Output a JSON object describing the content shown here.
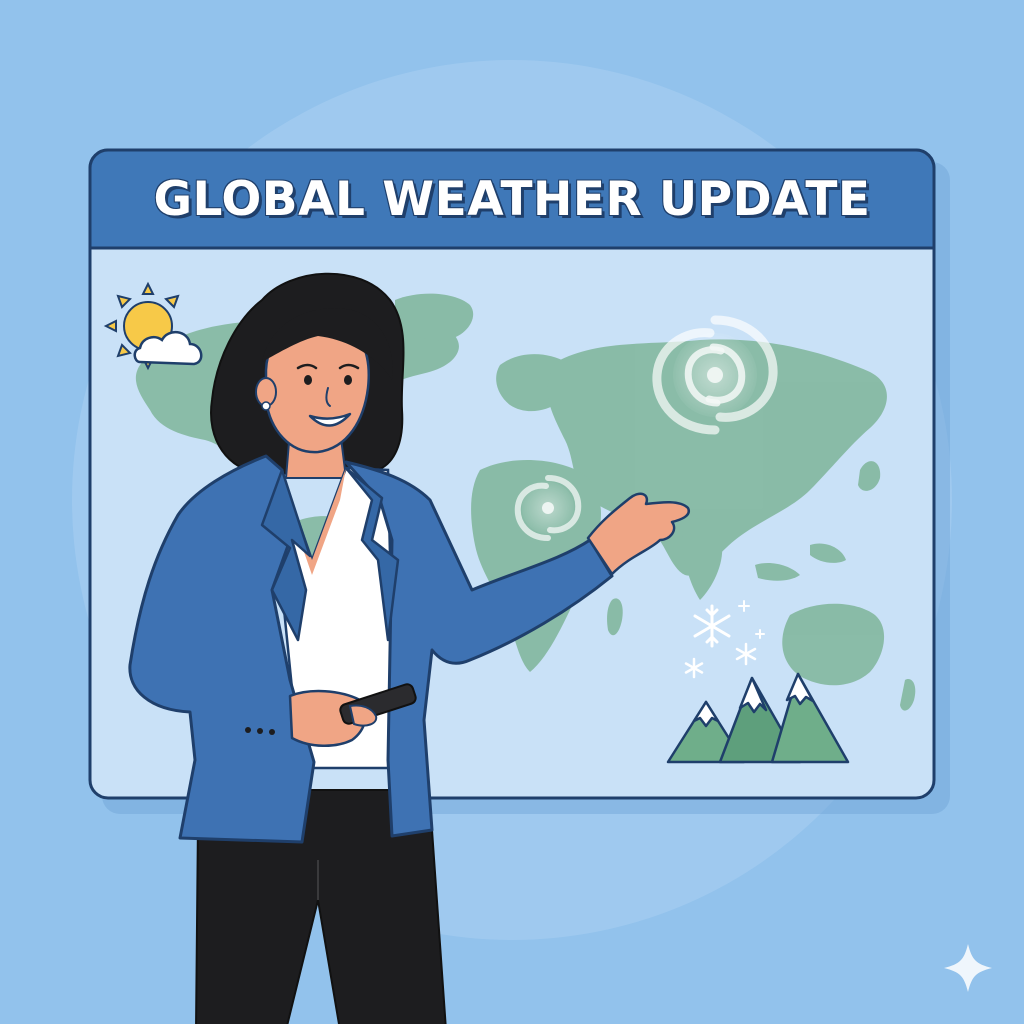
{
  "weather_board": {
    "title": "GLOBAL WEATHER UPDATE"
  },
  "icons": [
    "sun-cloud-icon",
    "hurricane-icon",
    "storm-swirl-icon",
    "snowflake-icon",
    "mountain-icon",
    "sparkle-icon"
  ],
  "colors": {
    "background": "#92c2ec",
    "board_header": "#3f78b8",
    "board_map": "#c9e1f7",
    "land": "#7fb59a",
    "jacket": "#3e72b3",
    "hair": "#1d1d1f",
    "skin": "#f0a585"
  }
}
